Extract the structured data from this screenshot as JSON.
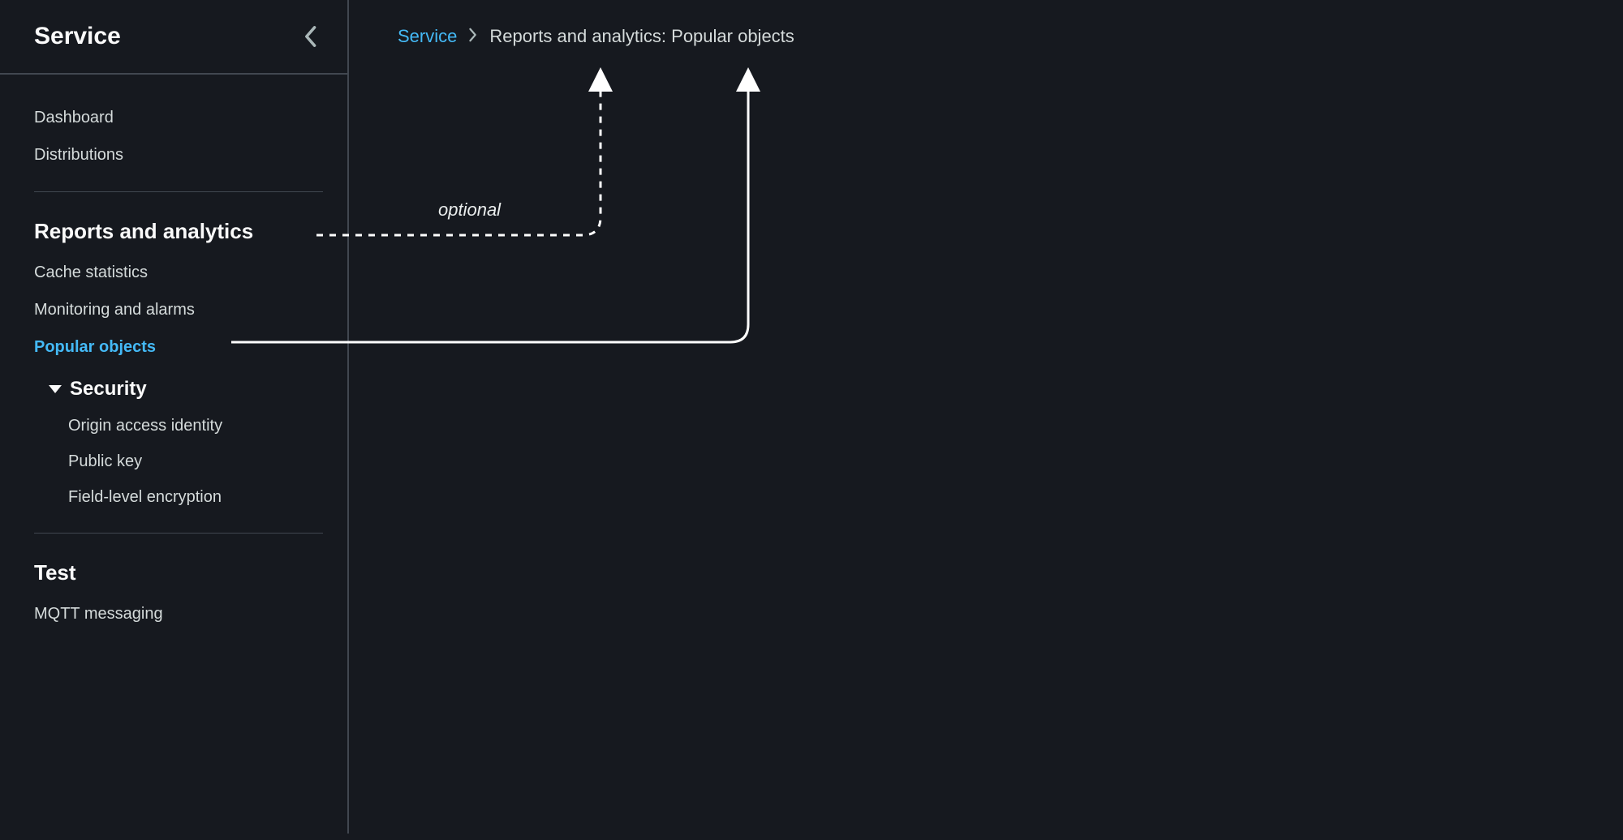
{
  "colors": {
    "background": "#16191f",
    "text": "#d5dbdb",
    "heading": "#fafafa",
    "accent": "#44b9f6",
    "divider": "#414750"
  },
  "sidebar": {
    "title": "Service",
    "groups": {
      "top": {
        "items": [
          {
            "label": "Dashboard"
          },
          {
            "label": "Distributions"
          }
        ]
      },
      "reports": {
        "heading": "Reports and analytics",
        "items": [
          {
            "label": "Cache statistics"
          },
          {
            "label": "Monitoring and alarms"
          },
          {
            "label": "Popular objects",
            "active": true
          }
        ],
        "subsection": {
          "heading": "Security",
          "expanded": true,
          "items": [
            {
              "label": "Origin access identity"
            },
            {
              "label": "Public key"
            },
            {
              "label": "Field-level encryption"
            }
          ]
        }
      },
      "test": {
        "heading": "Test",
        "items": [
          {
            "label": "MQTT messaging"
          }
        ]
      }
    }
  },
  "breadcrumb": {
    "root": "Service",
    "current": "Reports and analytics: Popular objects"
  },
  "annotation": {
    "optional_label": "optional"
  }
}
